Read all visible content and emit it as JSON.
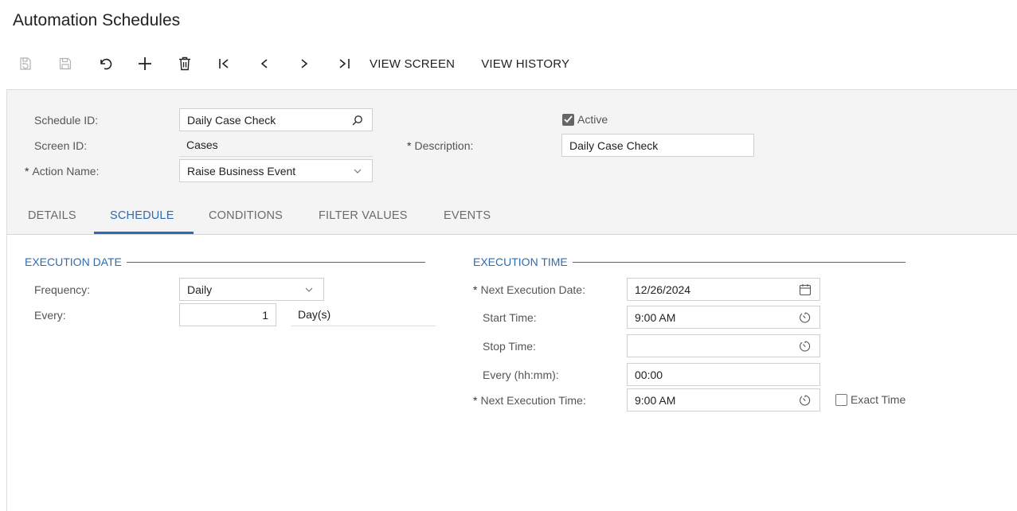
{
  "page": {
    "title": "Automation Schedules"
  },
  "toolbar": {
    "icons": [
      "discard-save-icon",
      "save-icon",
      "undo-icon",
      "add-icon",
      "delete-icon",
      "first-record-icon",
      "previous-record-icon",
      "next-record-icon",
      "last-record-icon"
    ],
    "view_screen": "VIEW SCREEN",
    "view_history": "VIEW HISTORY"
  },
  "form": {
    "schedule_id": {
      "label": "Schedule ID:",
      "value": "Daily Case Check"
    },
    "screen_id": {
      "label": "Screen ID:",
      "value": "Cases"
    },
    "action_name": {
      "label": "Action Name:",
      "value": "Raise Business Event"
    },
    "active": {
      "label": "Active",
      "checked": true
    },
    "description": {
      "label": "Description:",
      "value": "Daily Case Check"
    },
    "required_marker": "*"
  },
  "tabs": [
    {
      "label": "DETAILS",
      "active": false
    },
    {
      "label": "SCHEDULE",
      "active": true
    },
    {
      "label": "CONDITIONS",
      "active": false
    },
    {
      "label": "FILTER VALUES",
      "active": false
    },
    {
      "label": "EVENTS",
      "active": false
    }
  ],
  "execution_date": {
    "title": "EXECUTION DATE",
    "frequency": {
      "label": "Frequency:",
      "value": "Daily"
    },
    "every": {
      "label": "Every:",
      "value": "1",
      "unit": "Day(s)"
    }
  },
  "execution_time": {
    "title": "EXECUTION TIME",
    "next_execution_date": {
      "label": "Next Execution Date:",
      "value": "12/26/2024"
    },
    "start_time": {
      "label": "Start Time:",
      "value": "9:00 AM"
    },
    "stop_time": {
      "label": "Stop Time:",
      "value": ""
    },
    "every_hhmm": {
      "label": "Every (hh:mm):",
      "value": "00:00"
    },
    "next_execution_time": {
      "label": "Next Execution Time:",
      "value": "9:00 AM"
    },
    "exact_time": {
      "label": "Exact Time",
      "checked": false
    }
  },
  "colors": {
    "accent": "#2f6bb3",
    "panel": "#f4f4f4"
  }
}
